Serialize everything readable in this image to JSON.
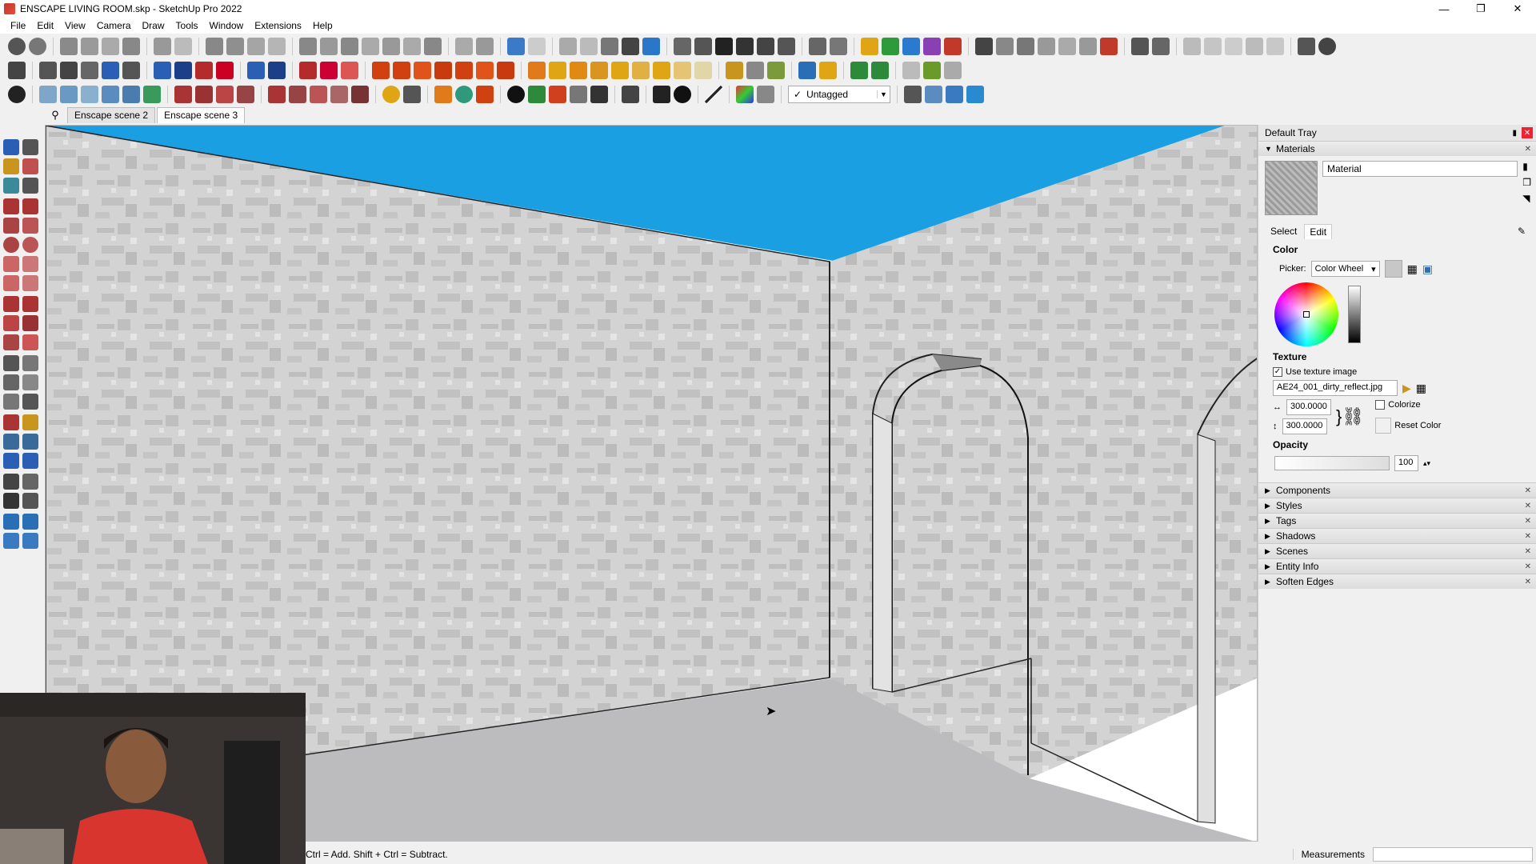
{
  "window": {
    "title": "ENSCAPE LIVING ROOM.skp - SketchUp Pro 2022",
    "minimize": "—",
    "maximize": "❐",
    "close": "✕"
  },
  "menu": [
    "File",
    "Edit",
    "View",
    "Camera",
    "Draw",
    "Tools",
    "Window",
    "Extensions",
    "Help"
  ],
  "toolbar": {
    "tag_check": "✓",
    "tag_value": "Untagged"
  },
  "scenes": {
    "search_icon": "⚲",
    "tabs": [
      "Enscape scene 2",
      "Enscape scene 3"
    ],
    "active": "Enscape scene 3"
  },
  "tray": {
    "title": "Default Tray",
    "pin": "▮",
    "close": "✕",
    "materials": {
      "header": "Materials",
      "name": "Material",
      "tabs": [
        "Select",
        "Edit"
      ],
      "active_tab": "Edit",
      "color_label": "Color",
      "picker_label": "Picker:",
      "picker_value": "Color Wheel",
      "texture_label": "Texture",
      "use_texture_label": "Use texture image",
      "use_texture_checked": "✓",
      "texture_file": "AE24_001_dirty_reflect.jpg",
      "width": "300.0000",
      "height": "300.0000",
      "colorize_label": "Colorize",
      "reset_color_label": "Reset Color",
      "opacity_label": "Opacity",
      "opacity_value": "100"
    },
    "panels": [
      "Components",
      "Styles",
      "Tags",
      "Shadows",
      "Scenes",
      "Entity Info",
      "Soften Edges"
    ]
  },
  "status": {
    "hint": "Ctrl = Add. Shift + Ctrl = Subtract.",
    "measurements_label": "Measurements"
  },
  "colors": {
    "sky": "#1aa0e2",
    "wall": "#cfcfcf",
    "floor": "#bcbcbf"
  }
}
